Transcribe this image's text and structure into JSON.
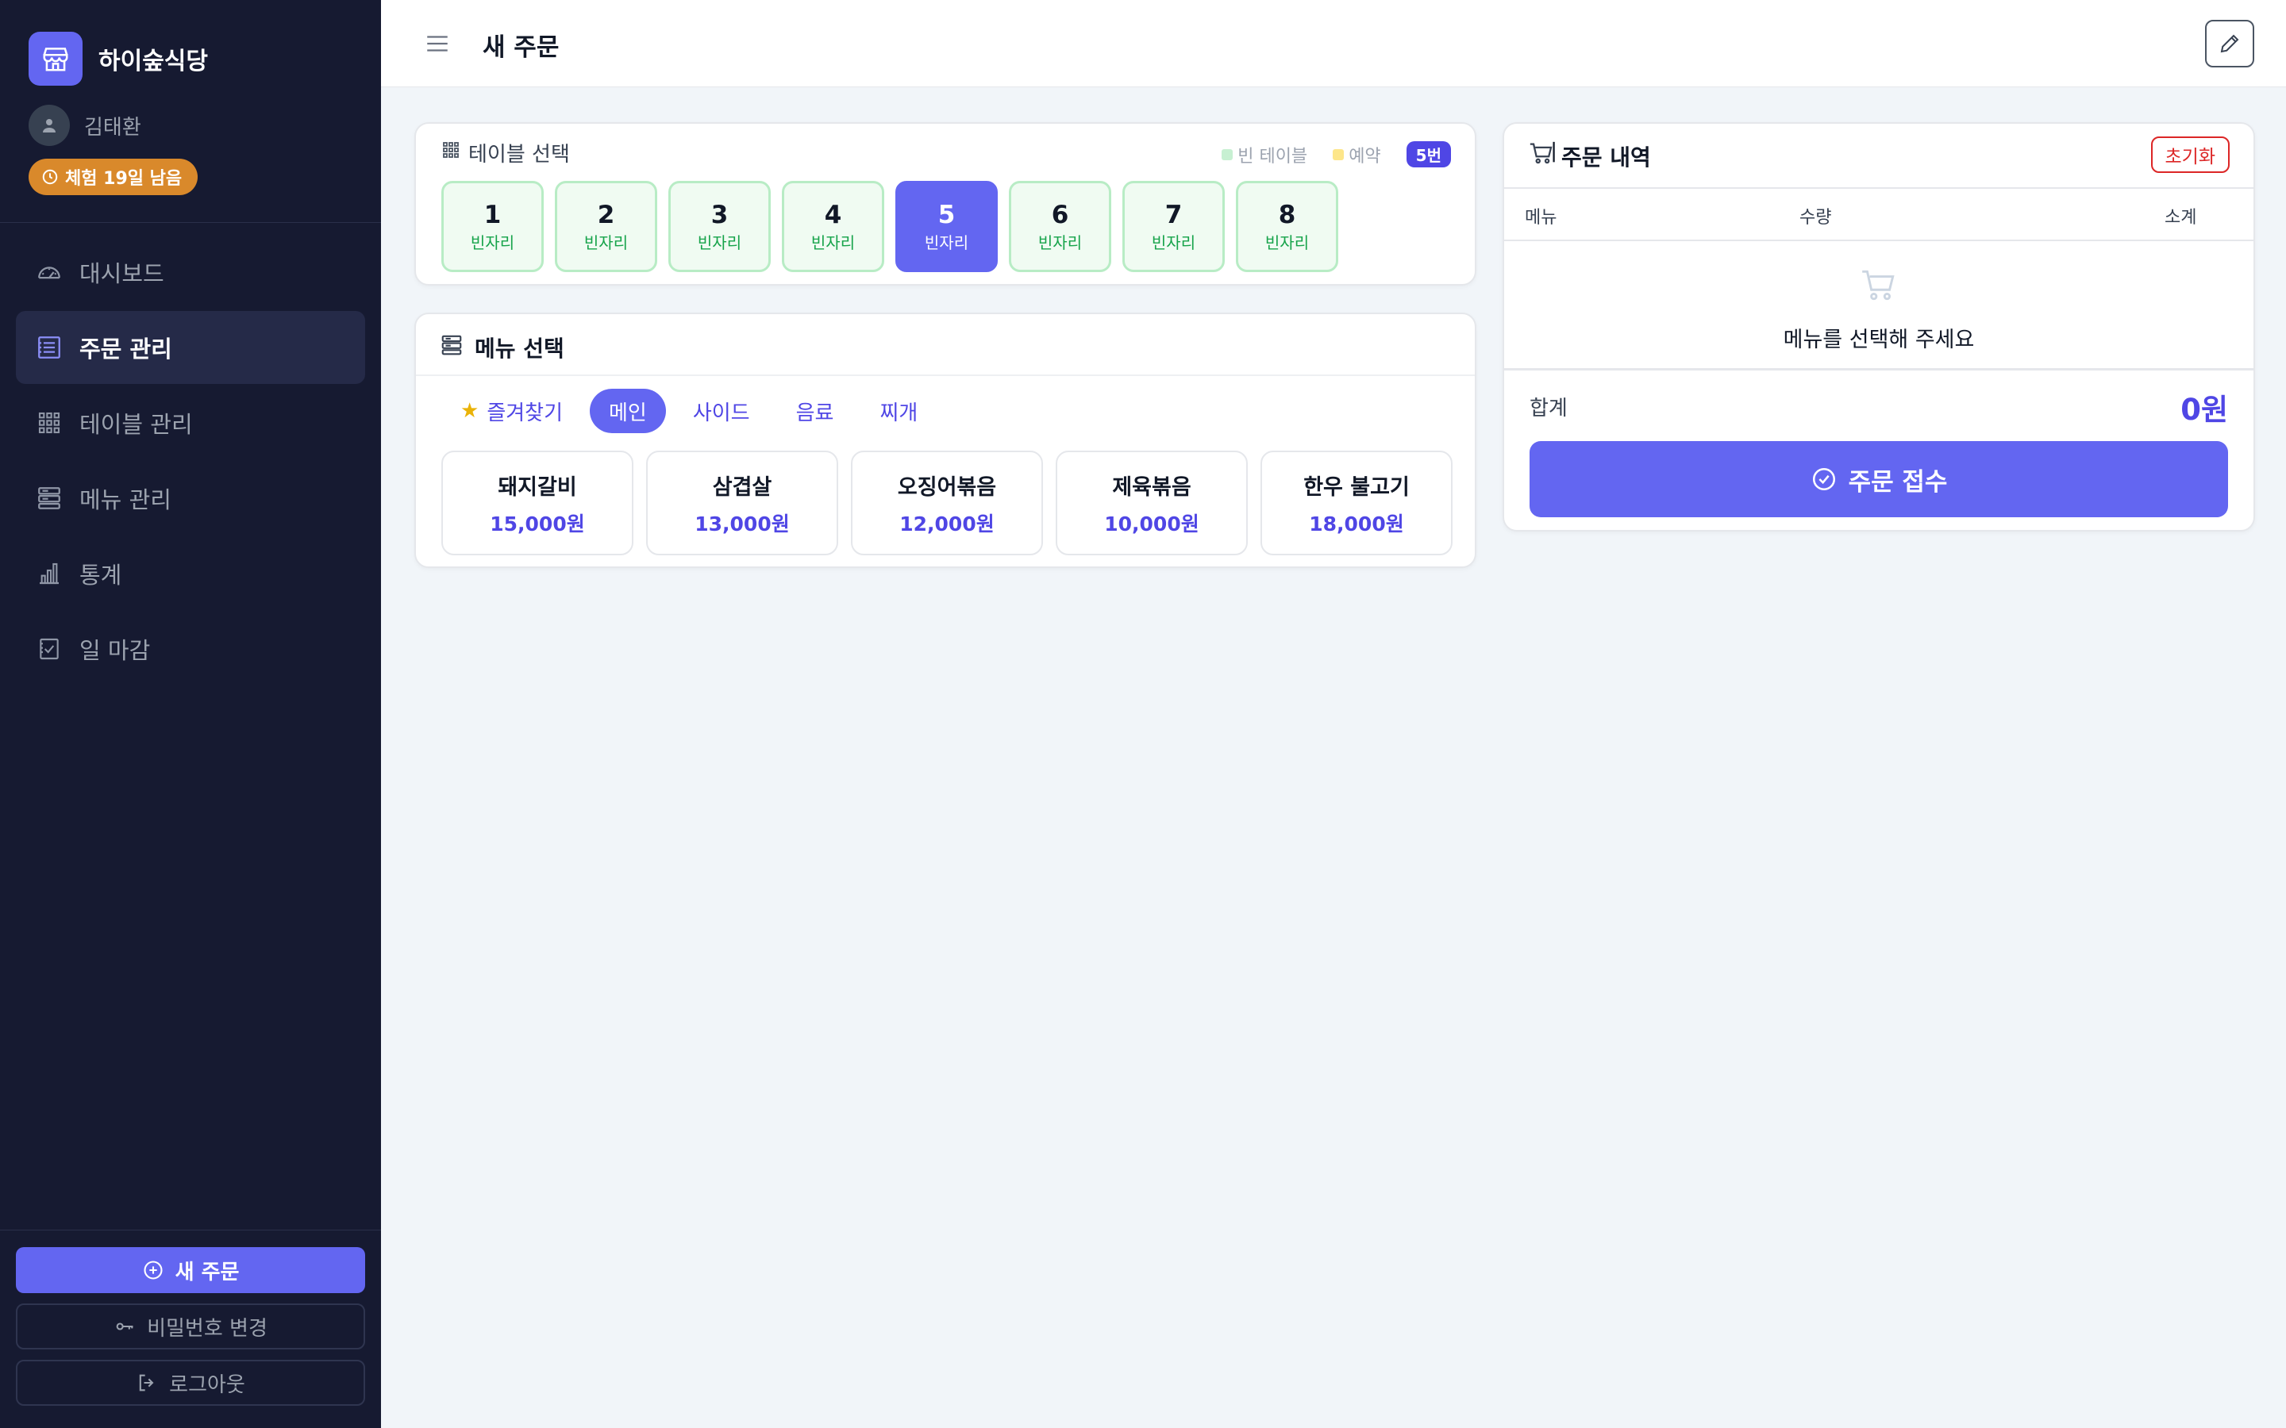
{
  "sidebar": {
    "brand_name": "하이숲식당",
    "user_name": "김태환",
    "trial_badge": "체험 19일 남음",
    "nav": [
      {
        "label": "대시보드",
        "icon": "dashboard-gauge-icon",
        "active": false
      },
      {
        "label": "주문 관리",
        "icon": "order-list-icon",
        "active": true
      },
      {
        "label": "테이블 관리",
        "icon": "grid-icon",
        "active": false
      },
      {
        "label": "메뉴 관리",
        "icon": "menu-list-icon",
        "active": false
      },
      {
        "label": "통계",
        "icon": "bar-chart-icon",
        "active": false
      },
      {
        "label": "일 마감",
        "icon": "checklist-icon",
        "active": false
      }
    ],
    "new_order_button": "새 주문",
    "change_password_button": "비밀번호 변경",
    "logout_button": "로그아웃"
  },
  "header": {
    "title": "새 주문"
  },
  "table_select": {
    "title": "테이블 선택",
    "legend_empty": "빈 테이블",
    "legend_reserved": "예약",
    "selected_badge": "5번",
    "tables": [
      {
        "number": "1",
        "status": "빈자리",
        "selected": false
      },
      {
        "number": "2",
        "status": "빈자리",
        "selected": false
      },
      {
        "number": "3",
        "status": "빈자리",
        "selected": false
      },
      {
        "number": "4",
        "status": "빈자리",
        "selected": false
      },
      {
        "number": "5",
        "status": "빈자리",
        "selected": true
      },
      {
        "number": "6",
        "status": "빈자리",
        "selected": false
      },
      {
        "number": "7",
        "status": "빈자리",
        "selected": false
      },
      {
        "number": "8",
        "status": "빈자리",
        "selected": false
      }
    ]
  },
  "menu_select": {
    "title": "메뉴 선택",
    "tabs": [
      {
        "label": "즐겨찾기",
        "active": false
      },
      {
        "label": "메인",
        "active": true
      },
      {
        "label": "사이드",
        "active": false
      },
      {
        "label": "음료",
        "active": false
      },
      {
        "label": "찌개",
        "active": false
      }
    ],
    "items": [
      {
        "name": "돼지갈비",
        "price": "15,000원"
      },
      {
        "name": "삼겹살",
        "price": "13,000원"
      },
      {
        "name": "오징어볶음",
        "price": "12,000원"
      },
      {
        "name": "제육볶음",
        "price": "10,000원"
      },
      {
        "name": "한우 불고기",
        "price": "18,000원"
      }
    ]
  },
  "order": {
    "title": "주문 내역",
    "reset_button": "초기화",
    "columns": {
      "menu": "메뉴",
      "qty": "수량",
      "subtotal": "소계"
    },
    "empty_message": "메뉴를 선택해 주세요",
    "total_label": "합계",
    "total_value": "0원",
    "submit_button": "주문 접수"
  },
  "colors": {
    "accent": "#6366f1",
    "sidebar_bg": "#161a31",
    "trial_badge": "#d9892b",
    "empty_table_border": "#b8ecc5",
    "danger": "#dc2626"
  }
}
